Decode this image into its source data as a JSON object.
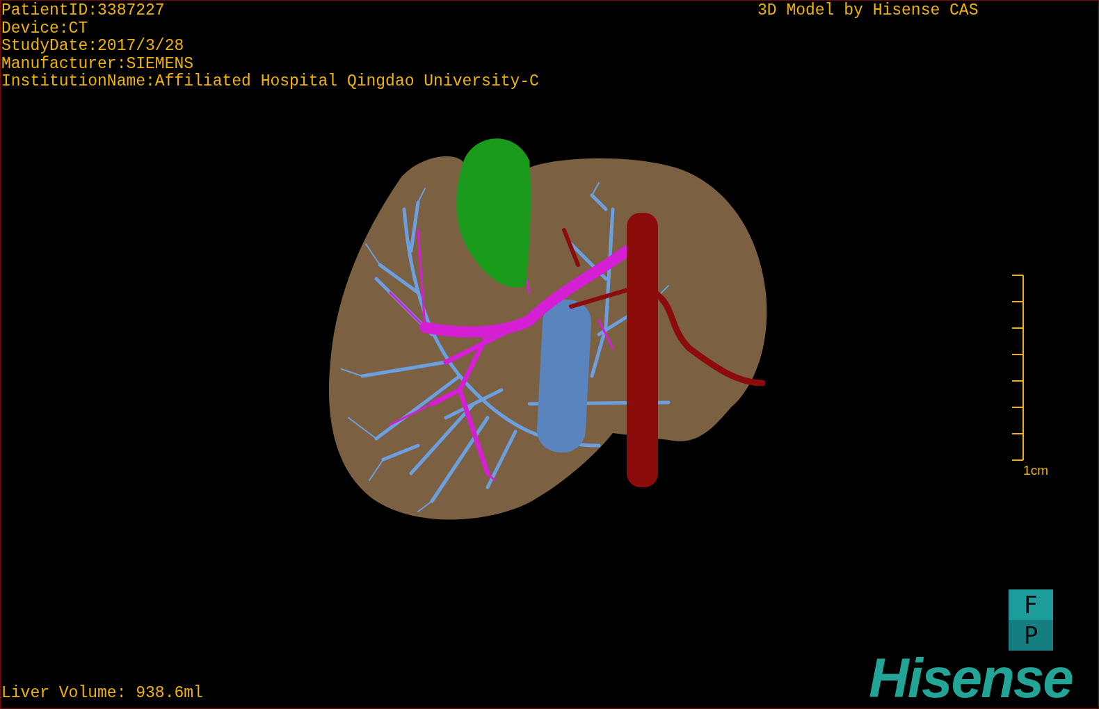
{
  "study_info": [
    "PatientID:3387227",
    "Device:CT",
    "StudyDate:2017/3/28",
    "Manufacturer:SIEMENS",
    "InstitutionName:Affiliated Hospital Qingdao University-C"
  ],
  "model_credit": "3D Model by Hisense CAS",
  "scale_bar": {
    "label": "1cm"
  },
  "orientation_buttons": [
    {
      "label": "F"
    },
    {
      "label": "P"
    }
  ],
  "brand": "Hisense",
  "liver_volume": "Liver Volume: 938.6ml"
}
